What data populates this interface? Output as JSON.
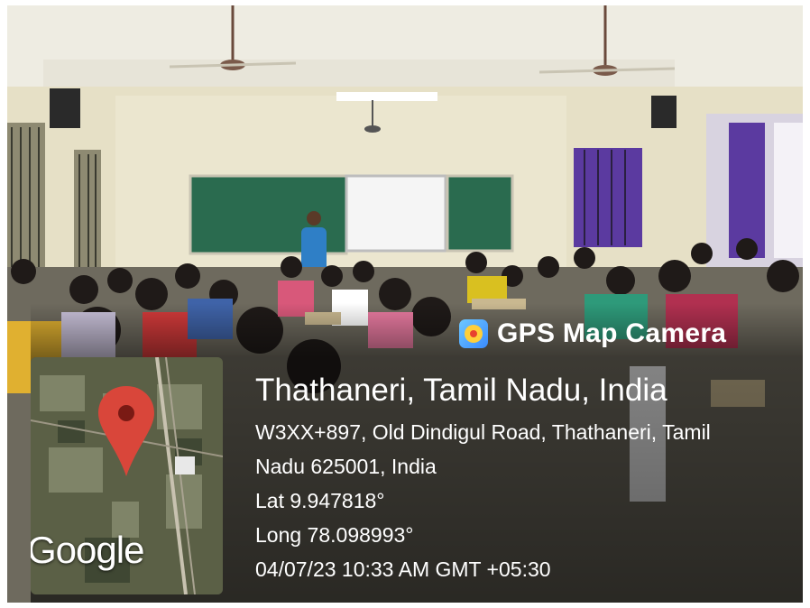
{
  "watermark": {
    "app_name": "GPS Map Camera",
    "location_title": "Thathaneri, Tamil Nadu, India",
    "address_line_1": "W3XX+897, Old Dindigul Road, Thathaneri, Tamil",
    "address_line_2": "Nadu 625001, India",
    "latitude": "Lat 9.947818°",
    "longitude": "Long 78.098993°",
    "timestamp": "04/07/23 10:33 AM GMT +05:30",
    "map_attribution": "Google",
    "pin_color": "#d9463a"
  },
  "scene": {
    "board_color": "#2a6b4f",
    "wall_color": "#e8e2c8",
    "ceiling_color": "#f2f0e6",
    "curtain_color": "#5b3aa0"
  }
}
